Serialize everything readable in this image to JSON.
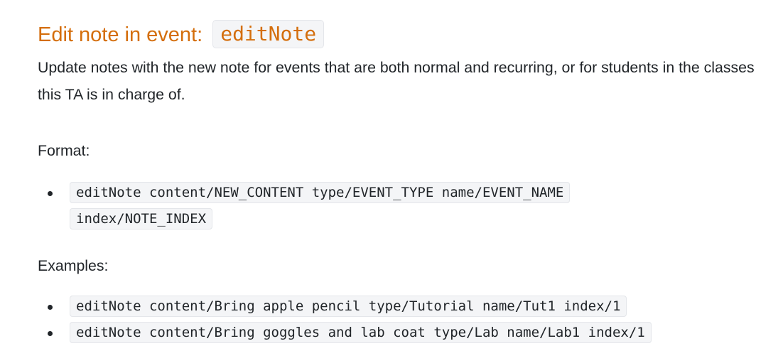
{
  "heading": {
    "text": "Edit note in event: ",
    "command": "editNote"
  },
  "description": "Update notes with the new note for events that are both normal and recurring, or for students in the classes this TA is in charge of.",
  "format": {
    "label": "Format:",
    "items": [
      "editNote content/NEW_CONTENT type/EVENT_TYPE name/EVENT_NAME index/NOTE_INDEX"
    ]
  },
  "examples": {
    "label": "Examples:",
    "items": [
      "editNote content/Bring apple pencil type/Tutorial name/Tut1 index/1",
      "editNote content/Bring goggles and lab coat type/Lab name/Lab1 index/1"
    ]
  },
  "colors": {
    "heading": "#d46e0c",
    "text": "#212529",
    "code_background": "#f4f5f7"
  },
  "icons": {
    "bullet": "bullet-dot-icon"
  }
}
